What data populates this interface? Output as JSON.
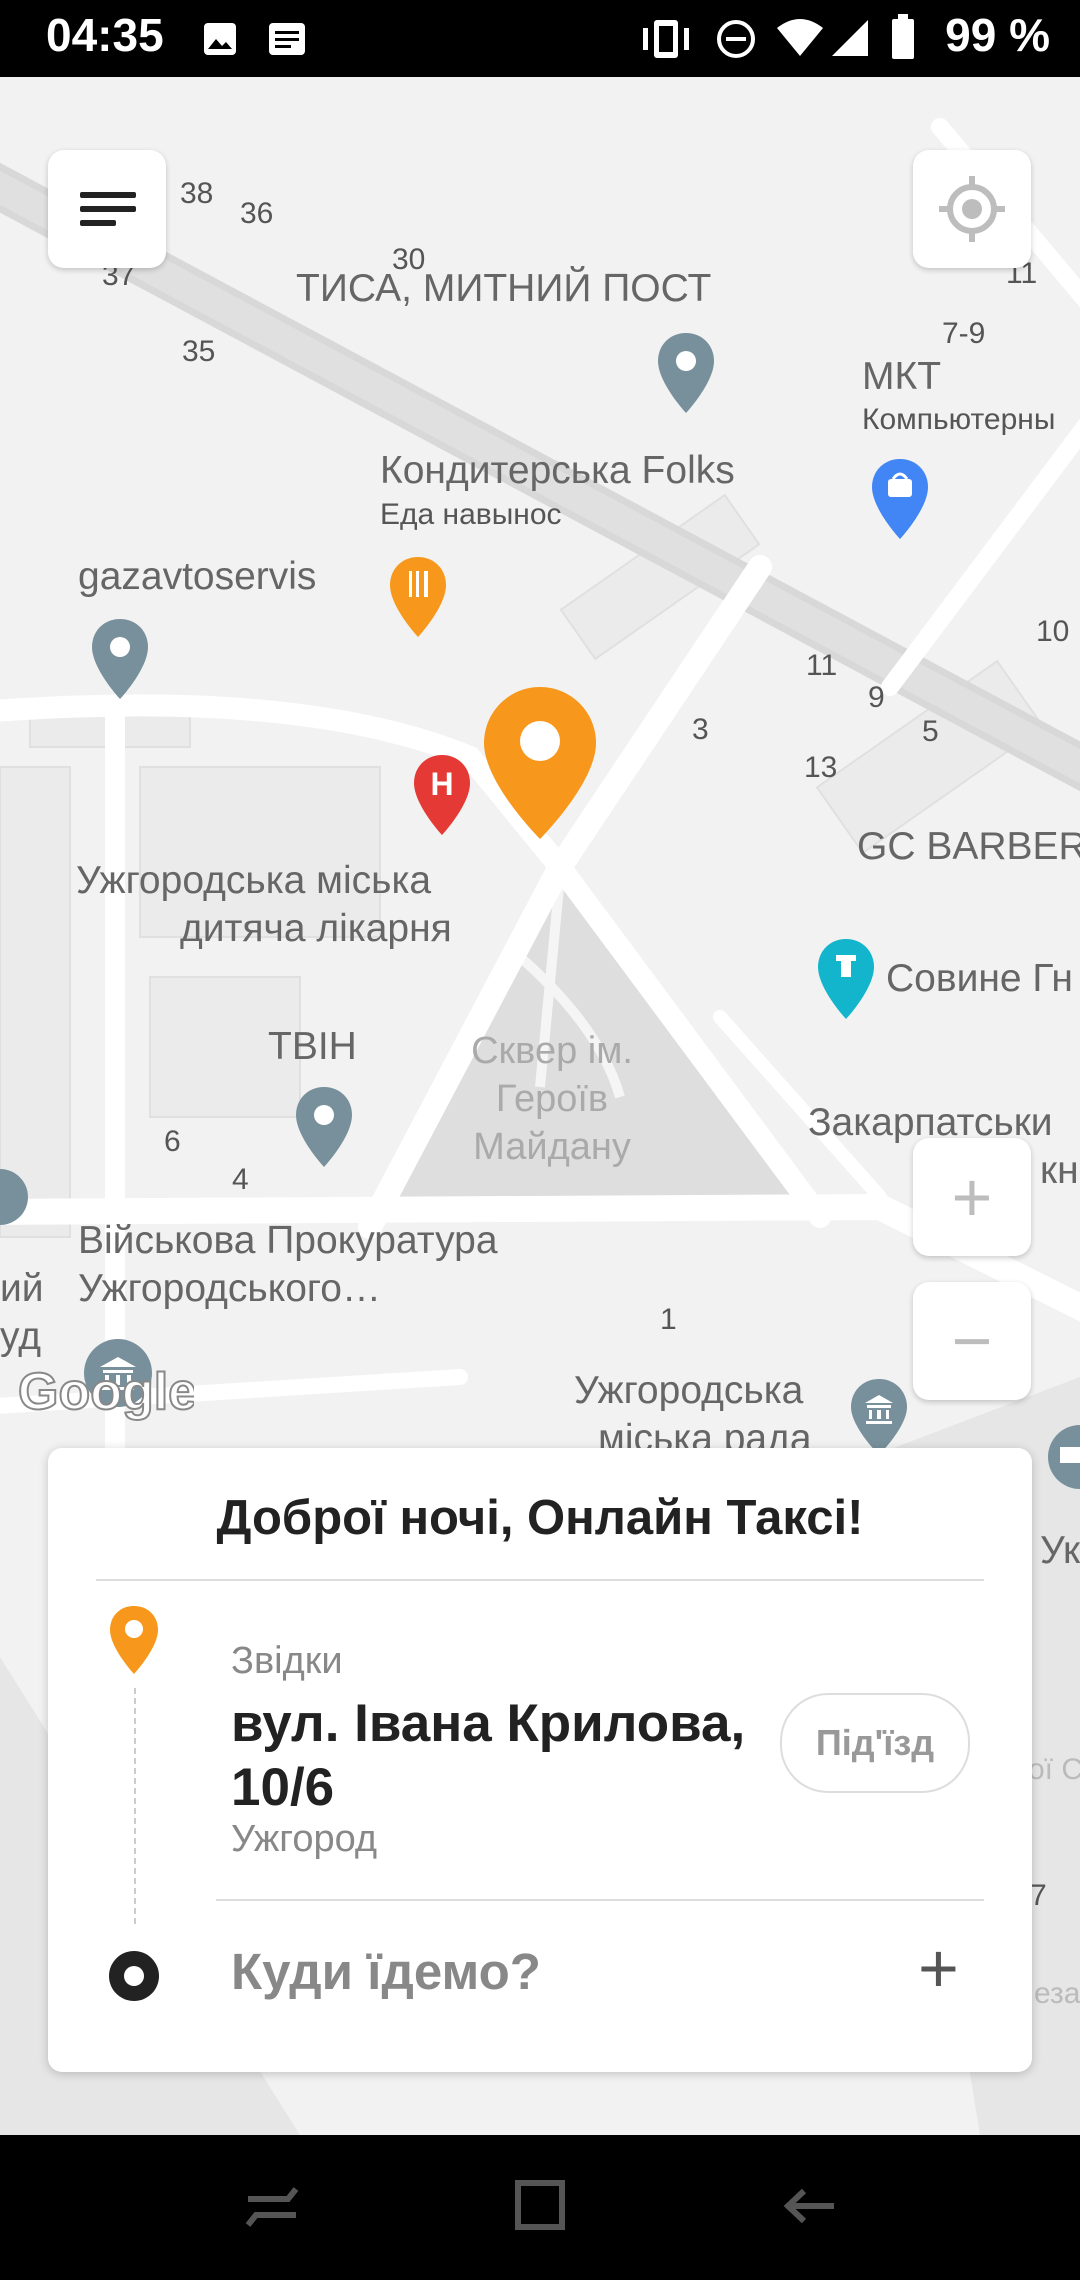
{
  "status_bar": {
    "time": "04:35",
    "battery": "99 %",
    "icons": [
      "image-icon",
      "message-icon",
      "vibrate-icon",
      "do-not-disturb-icon",
      "wifi-icon",
      "signal-icon",
      "battery-icon"
    ]
  },
  "map": {
    "labels": {
      "tysa": "ТИСА, МИТНИЙ ПОСТ",
      "mkt": "МКТ",
      "mkt_sub": "Компьютерны",
      "folks": "Кондитерська Folks",
      "folks_sub": "Еда навынос",
      "gazavto": "gazavtoservis",
      "hospital1": "Ужгородська міська",
      "hospital2": "дитяча лікарня",
      "gc": "GC BARBER",
      "sovyne": "Совине Гн",
      "tvin": "ТВІН",
      "park1": "Сквер ім.",
      "park2": "Героїв",
      "park3": "Майдану",
      "zakarp1": "Закарпатськи",
      "zakarp2": "кнії",
      "viyskova1": "Військова Прокуратура",
      "viyskova2": "Ужгородського…",
      "council1": "Ужгородська",
      "council2": "міська рада",
      "uzh_edge": "Ук",
      "left1": "ий",
      "left2": "уд",
      "street_edge1": "ої С",
      "street_edge2": "езал",
      "google": "Google"
    },
    "house_numbers": [
      "38",
      "36",
      "37",
      "30",
      "35",
      "11",
      "7-9",
      "10",
      "11",
      "9",
      "5",
      "3",
      "13",
      "6",
      "4",
      "1",
      "7"
    ],
    "pin_color": "#f7981c"
  },
  "controls": {
    "menu_icon": "menu-icon",
    "locate_icon": "locate-icon",
    "zoom_in": "+",
    "zoom_out": "−"
  },
  "card": {
    "greeting": "Доброї ночі, Онлайн Таксі!",
    "from_label": "Звідки",
    "from_address": "вул. Івана Крилова, 10/6",
    "from_city": "Ужгород",
    "entrance_button": "Під'їзд",
    "to_placeholder": "Куди їдемо?",
    "add_stop": "+"
  },
  "nav_bar": {
    "icons": [
      "recents-icon",
      "home-icon",
      "back-icon"
    ]
  },
  "colors": {
    "accent": "#f7981c",
    "text_dark": "#222222",
    "text_muted": "#888888"
  }
}
